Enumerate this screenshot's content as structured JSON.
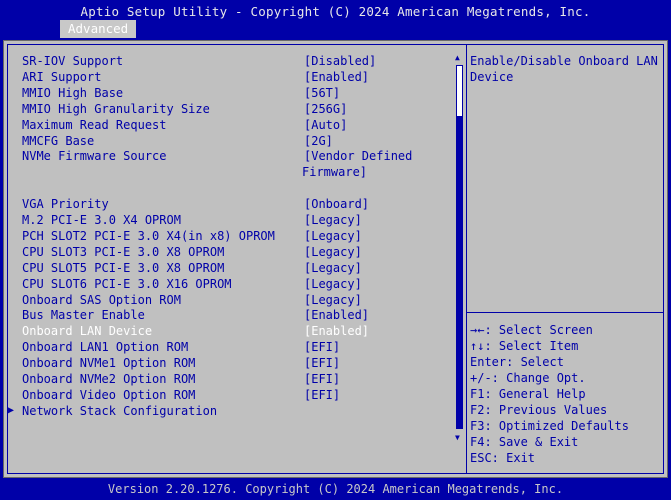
{
  "header": {
    "title": "Aptio Setup Utility - Copyright (C) 2024 American Megatrends, Inc.",
    "tab": "Advanced"
  },
  "settings": [
    {
      "label": "SR-IOV Support",
      "value": "[Disabled]"
    },
    {
      "label": "ARI Support",
      "value": "[Enabled]"
    },
    {
      "label": "MMIO High Base",
      "value": "[56T]"
    },
    {
      "label": "MMIO High Granularity Size",
      "value": "[256G]"
    },
    {
      "label": "Maximum Read Request",
      "value": "[Auto]"
    },
    {
      "label": "MMCFG Base",
      "value": "[2G]"
    },
    {
      "label": "NVMe Firmware Source",
      "value": "[Vendor Defined",
      "value_cont": "Firmware]"
    },
    {
      "label": "VGA Priority",
      "value": "[Onboard]"
    },
    {
      "label": "M.2 PCI-E 3.0 X4 OPROM",
      "value": "[Legacy]"
    },
    {
      "label": "PCH SLOT2 PCI-E 3.0 X4(in x8) OPROM",
      "value": "[Legacy]"
    },
    {
      "label": "CPU SLOT3 PCI-E 3.0 X8 OPROM",
      "value": "[Legacy]"
    },
    {
      "label": "CPU SLOT5 PCI-E 3.0 X8 OPROM",
      "value": "[Legacy]"
    },
    {
      "label": "CPU SLOT6 PCI-E 3.0 X16 OPROM",
      "value": "[Legacy]"
    },
    {
      "label": "Onboard SAS Option ROM",
      "value": "[Legacy]"
    },
    {
      "label": "Bus Master Enable",
      "value": "[Enabled]"
    },
    {
      "label": "Onboard LAN Device",
      "value": "[Enabled]",
      "selected": true
    },
    {
      "label": "Onboard LAN1 Option ROM",
      "value": "[EFI]"
    },
    {
      "label": "Onboard NVMe1 Option ROM",
      "value": "[EFI]"
    },
    {
      "label": "Onboard NVMe2 Option ROM",
      "value": "[EFI]"
    },
    {
      "label": "Onboard Video Option ROM",
      "value": "[EFI]"
    },
    {
      "label": "Network Stack Configuration",
      "submenu": true
    }
  ],
  "help": {
    "text_lines": [
      "Enable/Disable Onboard LAN",
      "Device"
    ]
  },
  "keys": [
    "→←: Select Screen",
    "↑↓: Select Item",
    "Enter: Select",
    "+/-: Change Opt.",
    "F1: General Help",
    "F2: Previous Values",
    "F3: Optimized Defaults",
    "F4: Save & Exit",
    "ESC: Exit"
  ],
  "scrollbar": {
    "position_fraction": 0.0,
    "visible_fraction": 0.14
  },
  "footer": "Version 2.20.1276. Copyright (C) 2024 American Megatrends, Inc.",
  "colors": {
    "background": "#0000a8",
    "panel": "#c0c0c0",
    "text": "#0000a8",
    "selected_text": "#ffffff"
  }
}
